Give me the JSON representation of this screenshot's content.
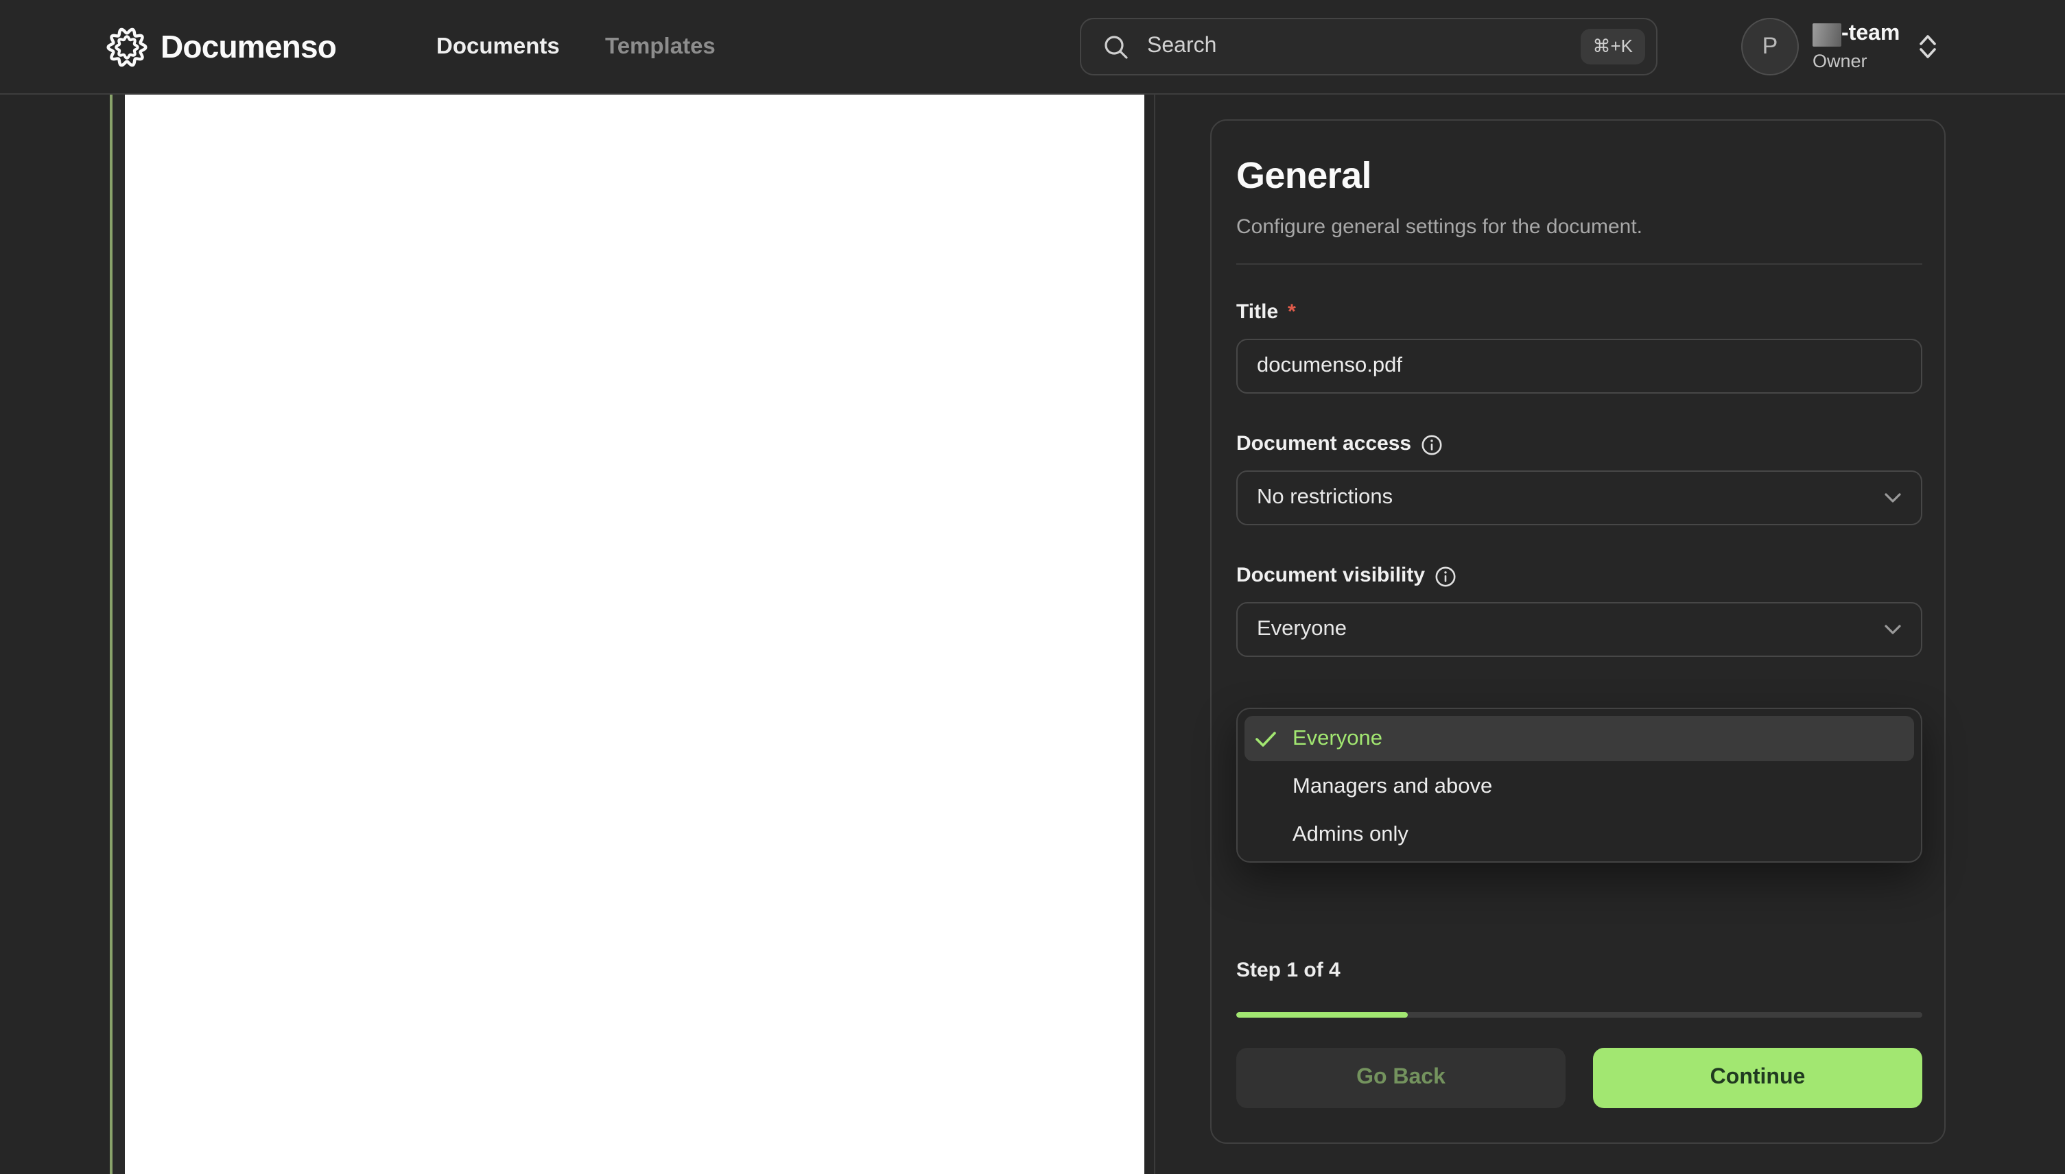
{
  "nav": {
    "brand": "Documenso",
    "links": {
      "documents": "Documents",
      "templates": "Templates"
    },
    "search": {
      "placeholder": "Search",
      "shortcut": "⌘+K"
    },
    "account": {
      "initial": "P",
      "team_suffix": "-team",
      "role": "Owner"
    }
  },
  "panel": {
    "title": "General",
    "subtitle": "Configure general settings for the document.",
    "title_field": {
      "label": "Title",
      "required_marker": "*",
      "value": "documenso.pdf"
    },
    "access_field": {
      "label": "Document access",
      "value": "No restrictions"
    },
    "visibility_field": {
      "label": "Document visibility",
      "value": "Everyone"
    },
    "visibility_options": [
      {
        "label": "Everyone",
        "selected": true
      },
      {
        "label": "Managers and above",
        "selected": false
      },
      {
        "label": "Admins only",
        "selected": false
      }
    ],
    "stepper": {
      "label": "Step 1 of 4",
      "progress_percent": 25
    },
    "actions": {
      "back": "Go Back",
      "continue": "Continue"
    }
  },
  "colors": {
    "accent": "#a2e771",
    "accent_text": "#203a20",
    "required": "#e25c4b",
    "page_edge": "#8aa46b"
  }
}
